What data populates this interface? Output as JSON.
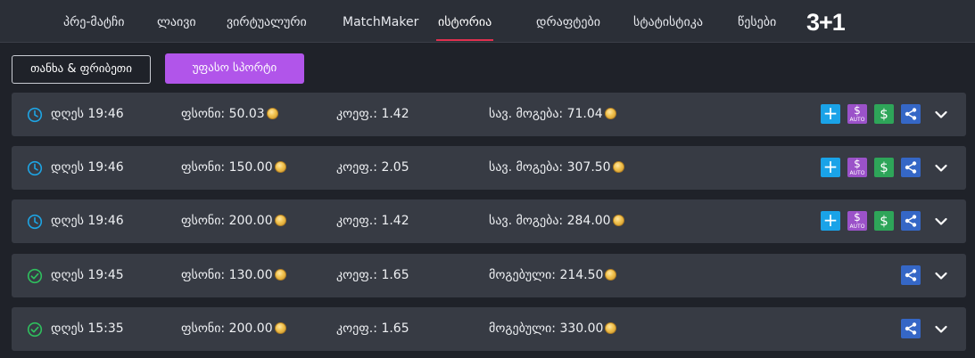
{
  "nav": {
    "items": [
      "პრე-მატჩი",
      "ლაივი",
      "ვირტუალური",
      "MatchMaker",
      "ისტორია",
      "დრაფტები",
      "სტატისტიკა",
      "წესები"
    ],
    "promo": "3+1"
  },
  "actions": {
    "cashout_label": "თანხა & ფრიბეთი",
    "freesport_label": "უფასო სპორტი"
  },
  "bets": [
    {
      "status": "pending",
      "date": "დღეს 19:46",
      "stake_label": "ფსონი:",
      "stake": "50.03",
      "odds_label": "კოეფ.:",
      "odds": "1.42",
      "win_label": "სავ. მოგება:",
      "win": "71.04"
    },
    {
      "status": "pending",
      "date": "დღეს 19:46",
      "stake_label": "ფსონი:",
      "stake": "150.00",
      "odds_label": "კოეფ.:",
      "odds": "2.05",
      "win_label": "სავ. მოგება:",
      "win": "307.50"
    },
    {
      "status": "pending",
      "date": "დღეს 19:46",
      "stake_label": "ფსონი:",
      "stake": "200.00",
      "odds_label": "კოეფ.:",
      "odds": "1.42",
      "win_label": "სავ. მოგება:",
      "win": "284.00"
    },
    {
      "status": "won",
      "date": "დღეს 19:45",
      "stake_label": "ფსონი:",
      "stake": "130.00",
      "odds_label": "კოეფ.:",
      "odds": "1.65",
      "win_label": "მოგებული:",
      "win": "214.50"
    },
    {
      "status": "won",
      "date": "დღეს 15:35",
      "stake_label": "ფსონი:",
      "stake": "200.00",
      "odds_label": "კოეფ.:",
      "odds": "1.65",
      "win_label": "მოგებული:",
      "win": "330.00"
    }
  ],
  "button_glyphs": {
    "plus": "+",
    "dollar": "$",
    "auto": "AUTO"
  },
  "colors": {
    "accent_purple": "#b155ea",
    "active_underline": "#e0304f",
    "pending_icon": "#1ea4e3",
    "won_icon": "#2fbf5e",
    "add_button": "#1aa3e8",
    "auto_button": "#9b52c9",
    "cashout_button": "#2ea559",
    "share_button": "#3567c6"
  },
  "icons": {
    "pending": "clock-icon",
    "won": "check-circle-icon",
    "add": "plus-icon",
    "auto": "auto-cashout-icon",
    "cashout": "dollar-icon",
    "share": "share-icon",
    "expand": "chevron-down-icon"
  }
}
